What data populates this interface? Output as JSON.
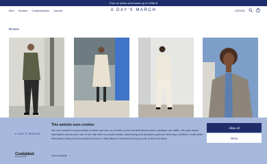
{
  "promo_bar": {
    "text": "Free of duties and taxes up to 2950 $"
  },
  "header": {
    "nav": [
      "Men",
      "Women",
      "Collaborations",
      "Journal"
    ],
    "logo": "A DAY'S MARCH",
    "currency": "US/USD",
    "icons": [
      "search-icon",
      "bag-icon"
    ]
  },
  "section": {
    "title": "Browse"
  },
  "tiles": [
    {
      "subject": "man in olive jacket and dark trousers"
    },
    {
      "subject": "person in beige trench coat"
    },
    {
      "subject": "person in cream suit"
    },
    {
      "subject": "woman in checked blazer"
    }
  ],
  "cookie_banner": {
    "brand": "A DAY'S MARCH",
    "title": "This website uses cookies",
    "text": "We use cookies to personalise content and ads, to provide social media features and to analyse our traffic. We also share information about your use of our site with our social media, advertising and analytics partners who may combine it with other information that you've provided to them or that they've collected from your use of their services.",
    "show_details": "Show details",
    "show_details_icon": "›",
    "allow_all": "Allow all",
    "deny": "Deny",
    "provider": "Cookiebot",
    "provider_sub": "by Usercentrics"
  },
  "colors": {
    "navy": "#1f2e6b",
    "banner": "#a6b8dc"
  }
}
